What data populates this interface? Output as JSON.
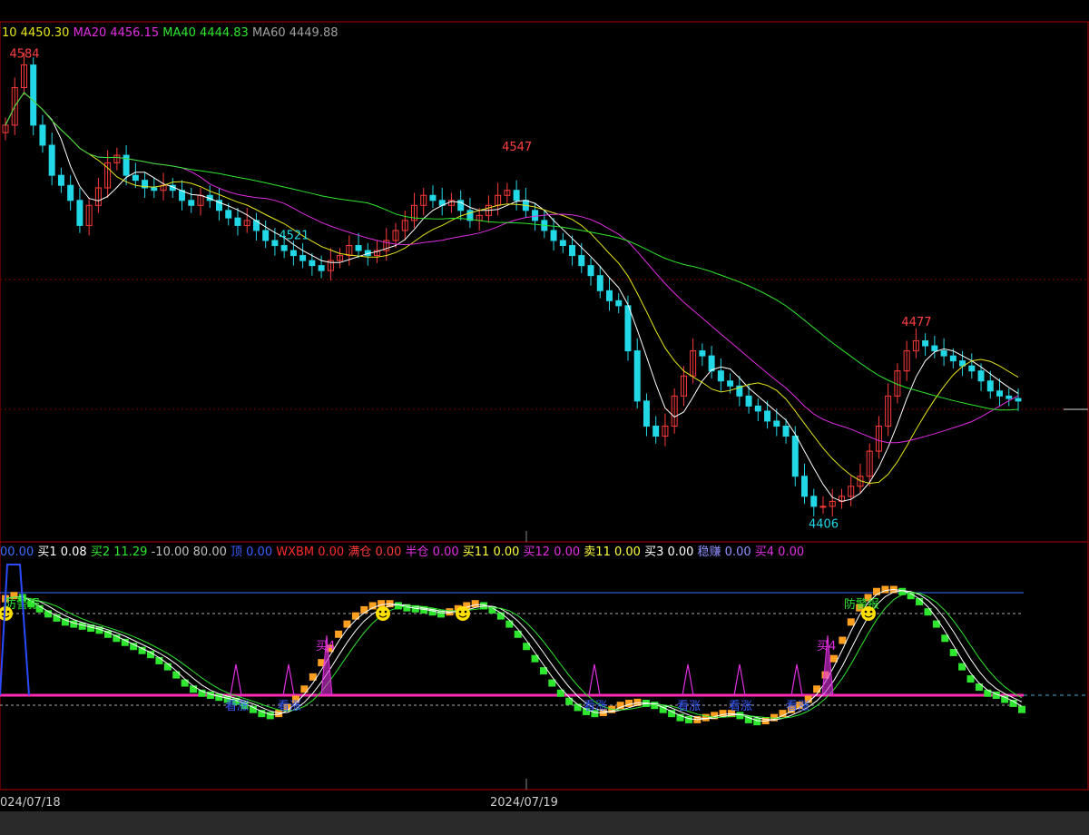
{
  "header": {
    "items": [
      {
        "label": "10",
        "value": "4450.30",
        "color": "#e6e61a"
      },
      {
        "label": "MA20",
        "value": "4456.15",
        "color": "#e02ee0"
      },
      {
        "label": "MA40",
        "value": "4444.83",
        "color": "#2ee62e"
      },
      {
        "label": "MA60",
        "value": "4449.88",
        "color": "#a0a0a0"
      }
    ]
  },
  "sub_header": {
    "items": [
      {
        "label": "",
        "value": "00.00",
        "color": "#3a6cff"
      },
      {
        "label": "买1",
        "value": "0.08",
        "color": "#ffffff"
      },
      {
        "label": "买2",
        "value": "11.29",
        "color": "#2ee62e"
      },
      {
        "label": "",
        "value": "-10.00",
        "color": "#c0c0c0"
      },
      {
        "label": "",
        "value": "80.00",
        "color": "#c0c0c0"
      },
      {
        "label": "顶",
        "value": "0.00",
        "color": "#3a5cff"
      },
      {
        "label": "WXBM",
        "value": "0.00",
        "color": "#ff2b2b"
      },
      {
        "label": "满仓",
        "value": "0.00",
        "color": "#ff3a3a"
      },
      {
        "label": "半仓",
        "value": "0.00",
        "color": "#e02ee0"
      },
      {
        "label": "买11",
        "value": "0.00",
        "color": "#ffff40"
      },
      {
        "label": "买12",
        "value": "0.00",
        "color": "#e02ee0"
      },
      {
        "label": "卖11",
        "value": "0.00",
        "color": "#ffff40"
      },
      {
        "label": "买3",
        "value": "0.00",
        "color": "#ffffff"
      },
      {
        "label": "稳赚",
        "value": "0.00",
        "color": "#9090ff"
      },
      {
        "label": "买4",
        "value": "0.00",
        "color": "#e02ee0"
      }
    ]
  },
  "dates": [
    "024/07/18",
    "2024/07/19"
  ],
  "annotations": {
    "warn_label": "防警报",
    "buy4_label": "买4",
    "fall_label": "看涨"
  },
  "chart_data": {
    "type": "candlestick",
    "price_labels": [
      {
        "text": "4584",
        "kind": "high"
      },
      {
        "text": "4547",
        "kind": "high"
      },
      {
        "text": "4521",
        "kind": "low"
      },
      {
        "text": "4477",
        "kind": "high"
      },
      {
        "text": "4406",
        "kind": "low"
      }
    ],
    "ylim": [
      4400,
      4590
    ],
    "ma_latest": {
      "MA10": 4450.3,
      "MA20": 4456.15,
      "MA40": 4444.83,
      "MA60": 4449.88
    },
    "close_path": [
      4560,
      4575,
      4584,
      4560,
      4552,
      4540,
      4536,
      4530,
      4520,
      4528,
      4535,
      4545,
      4548,
      4540,
      4538,
      4535,
      4534,
      4536,
      4534,
      4530,
      4528,
      4532,
      4530,
      4526,
      4523,
      4520,
      4522,
      4518,
      4514,
      4512,
      4510,
      4508,
      4506,
      4504,
      4502,
      4506,
      4508,
      4512,
      4510,
      4508,
      4510,
      4514,
      4518,
      4522,
      4528,
      4532,
      4530,
      4528,
      4530,
      4526,
      4522,
      4524,
      4528,
      4532,
      4534,
      4530,
      4526,
      4522,
      4518,
      4514,
      4512,
      4508,
      4504,
      4500,
      4494,
      4490,
      4488,
      4470,
      4450,
      4440,
      4436,
      4440,
      4452,
      4460,
      4470,
      4468,
      4462,
      4458,
      4456,
      4452,
      4448,
      4446,
      4442,
      4440,
      4436,
      4420,
      4412,
      4408,
      4408,
      4410,
      4412,
      4416,
      4420,
      4430,
      4440,
      4452,
      4462,
      4470,
      4474,
      4472,
      4470,
      4468,
      4466,
      4464,
      4462,
      4458,
      4454,
      4452,
      4451,
      4450
    ],
    "osc_line": [
      95,
      98,
      96,
      90,
      85,
      80,
      76,
      72,
      70,
      68,
      66,
      64,
      60,
      56,
      52,
      48,
      44,
      40,
      34,
      28,
      20,
      12,
      6,
      2,
      0,
      -2,
      -4,
      -6,
      -10,
      -14,
      -18,
      -20,
      -18,
      -12,
      -4,
      6,
      18,
      32,
      46,
      60,
      70,
      78,
      84,
      88,
      90,
      90,
      88,
      86,
      85,
      84,
      82,
      80,
      82,
      85,
      88,
      90,
      88,
      84,
      78,
      70,
      60,
      48,
      36,
      24,
      12,
      2,
      -6,
      -12,
      -16,
      -18,
      -17,
      -14,
      -10,
      -8,
      -7,
      -8,
      -10,
      -14,
      -18,
      -22,
      -24,
      -24,
      -22,
      -20,
      -18,
      -18,
      -20,
      -24,
      -26,
      -25,
      -22,
      -18,
      -14,
      -10,
      -4,
      6,
      20,
      36,
      54,
      72,
      86,
      96,
      102,
      104,
      104,
      102,
      98,
      92,
      82,
      70,
      56,
      42,
      28,
      16,
      8,
      2,
      0,
      -4,
      -8,
      -14
    ]
  }
}
